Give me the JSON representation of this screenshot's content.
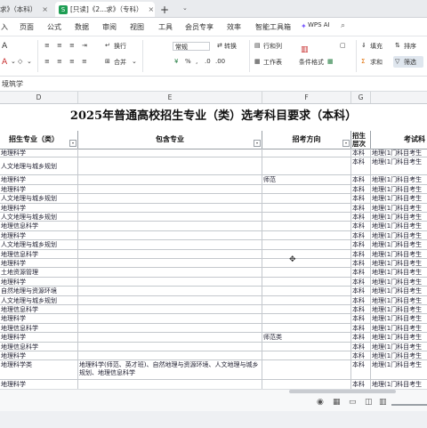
{
  "tabs": [
    {
      "label": "求》（本科）",
      "close": "×"
    },
    {
      "label": "[只读]《2...求》（专科）",
      "close": "×"
    },
    {
      "label": "+"
    }
  ],
  "menu": {
    "items": [
      "页面",
      "公式",
      "数据",
      "审阅",
      "视图",
      "工具",
      "会员专享",
      "效率",
      "智能工具箱"
    ],
    "left_cut": "入",
    "wps_ai": "WPS AI"
  },
  "ribbon": {
    "wrap": "换行",
    "merge": "合并",
    "format_select": "常规",
    "convert": "转换",
    "rows_cols": "行和列",
    "worksheet": "工作表",
    "cond_format": "条件格式",
    "fill": "填充",
    "sort": "排序",
    "sum": "求和",
    "filter": "筛选"
  },
  "formula": {
    "value": "境筑学"
  },
  "columns": [
    "D",
    "E",
    "F",
    "G"
  ],
  "sheet": {
    "title": "2025年普通高校招生专业（类）选考科目要求（本科）",
    "headers": {
      "major": "招生专业（类）",
      "included": "包含专业",
      "direction": "招考方向",
      "level": "招生层次",
      "subject": "考试科"
    },
    "rows": [
      {
        "major": "地理科学",
        "included": "",
        "direction": "",
        "level": "本科",
        "subject": "地理(1门科目考生"
      },
      {
        "major": "人文地理与城乡规划",
        "included": "",
        "direction": "",
        "level": "本科",
        "subject": "地理(1门科目考生"
      },
      {
        "major": "地理科学",
        "included": "",
        "direction": "师范",
        "level": "本科",
        "subject": "地理(1门科目考生"
      },
      {
        "major": "地理科学",
        "included": "",
        "direction": "",
        "level": "本科",
        "subject": "地理(1门科目考生"
      },
      {
        "major": "人文地理与城乡规划",
        "included": "",
        "direction": "",
        "level": "本科",
        "subject": "地理(1门科目考生"
      },
      {
        "major": "地理科学",
        "included": "",
        "direction": "",
        "level": "本科",
        "subject": "地理(1门科目考生"
      },
      {
        "major": "人文地理与城乡规划",
        "included": "",
        "direction": "",
        "level": "本科",
        "subject": "地理(1门科目考生"
      },
      {
        "major": "地理信息科学",
        "included": "",
        "direction": "",
        "level": "本科",
        "subject": "地理(1门科目考生"
      },
      {
        "major": "地理科学",
        "included": "",
        "direction": "",
        "level": "本科",
        "subject": "地理(1门科目考生"
      },
      {
        "major": "人文地理与城乡规划",
        "included": "",
        "direction": "",
        "level": "本科",
        "subject": "地理(1门科目考生"
      },
      {
        "major": "地理信息科学",
        "included": "",
        "direction": "",
        "level": "本科",
        "subject": "地理(1门科目考生"
      },
      {
        "major": "地理科学",
        "included": "",
        "direction": "",
        "level": "本科",
        "subject": "地理(1门科目考生"
      },
      {
        "major": "土地资源管理",
        "included": "",
        "direction": "",
        "level": "本科",
        "subject": "地理(1门科目考生"
      },
      {
        "major": "地理科学",
        "included": "",
        "direction": "",
        "level": "本科",
        "subject": "地理(1门科目考生"
      },
      {
        "major": "自然地理与资源环境",
        "included": "",
        "direction": "",
        "level": "本科",
        "subject": "地理(1门科目考生"
      },
      {
        "major": "人文地理与城乡规划",
        "included": "",
        "direction": "",
        "level": "本科",
        "subject": "地理(1门科目考生"
      },
      {
        "major": "地理信息科学",
        "included": "",
        "direction": "",
        "level": "本科",
        "subject": "地理(1门科目考生"
      },
      {
        "major": "地理科学",
        "included": "",
        "direction": "",
        "level": "本科",
        "subject": "地理(1门科目考生"
      },
      {
        "major": "地理信息科学",
        "included": "",
        "direction": "",
        "level": "本科",
        "subject": "地理(1门科目考生"
      },
      {
        "major": "地理科学",
        "included": "",
        "direction": "师范类",
        "level": "本科",
        "subject": "地理(1门科目考生"
      },
      {
        "major": "地理信息科学",
        "included": "",
        "direction": "",
        "level": "本科",
        "subject": "地理(1门科目考生"
      },
      {
        "major": "地理科学",
        "included": "",
        "direction": "",
        "level": "本科",
        "subject": "地理(1门科目考生"
      },
      {
        "major": "地理科学类",
        "included": "地理科学(师范、英才班)、自然地理与资源环境、人文地理与城乡规划、地理信息科学",
        "direction": "",
        "level": "本科",
        "subject": "地理(1门科目考生"
      },
      {
        "major": "地理科学",
        "included": "",
        "direction": "",
        "level": "本科",
        "subject": "地理(1门科目考生"
      }
    ]
  },
  "status": {
    "icons": [
      "eye-icon",
      "grid-view-icon",
      "page-view-icon",
      "split-view-icon",
      "reading-mode-icon"
    ]
  }
}
